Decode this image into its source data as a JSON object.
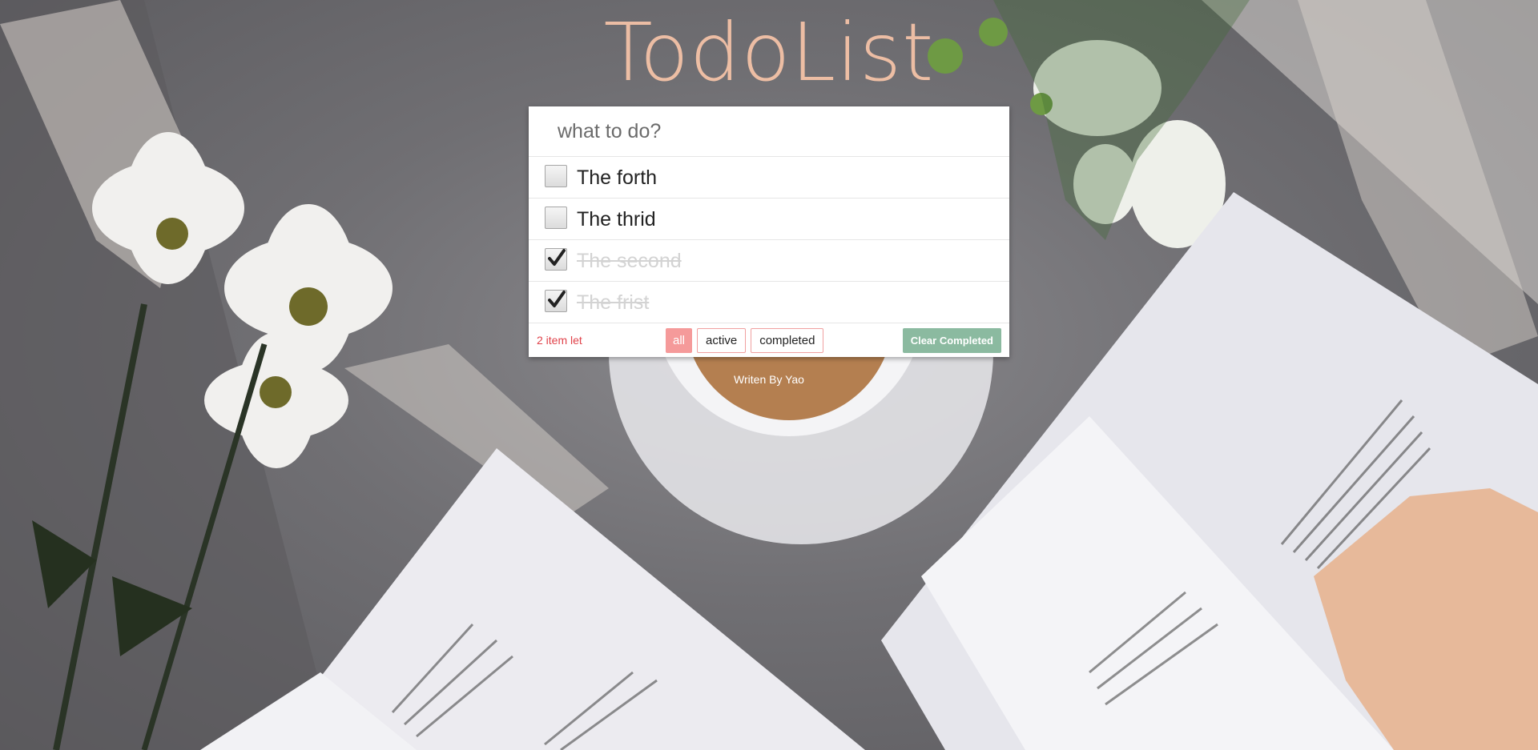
{
  "header": {
    "title": "TodoList"
  },
  "new_todo": {
    "placeholder": "what to do?"
  },
  "todos": [
    {
      "text": "The forth",
      "completed": false
    },
    {
      "text": "The thrid",
      "completed": false
    },
    {
      "text": "The second",
      "completed": true
    },
    {
      "text": "The frist",
      "completed": true
    }
  ],
  "footer": {
    "items_left": "2 item let",
    "filters": [
      {
        "label": "all",
        "selected": true
      },
      {
        "label": "active",
        "selected": false
      },
      {
        "label": "completed",
        "selected": false
      }
    ],
    "clear_label": "Clear Completed"
  },
  "credit": "Writen By Yao",
  "colors": {
    "title": "#f7c4a8",
    "items_left": "#e0424a",
    "filter_selected": "#f59a9a",
    "filter_border": "#f0a0a0",
    "clear_button": "#8bbaa0"
  }
}
